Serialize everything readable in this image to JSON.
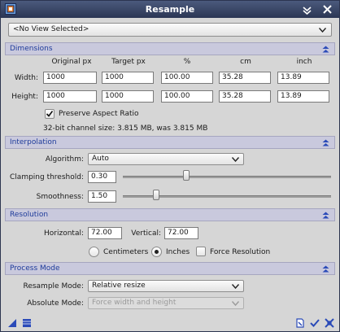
{
  "window": {
    "title": "Resample"
  },
  "view_selector": {
    "value": "<No View Selected>"
  },
  "dimensions": {
    "section_label": "Dimensions",
    "col_headers": [
      "Original px",
      "Target px",
      "%",
      "cm",
      "inch"
    ],
    "width_label": "Width:",
    "height_label": "Height:",
    "width_values": [
      "1000",
      "1000",
      "100.00",
      "35.28",
      "13.89"
    ],
    "height_values": [
      "1000",
      "1000",
      "100.00",
      "35.28",
      "13.89"
    ],
    "preserve_aspect_label": "Preserve Aspect Ratio",
    "preserve_aspect_checked": true,
    "channel_size_text": "32-bit channel size: 3.815 MB, was 3.815 MB"
  },
  "interpolation": {
    "section_label": "Interpolation",
    "algorithm_label": "Algorithm:",
    "algorithm_value": "Auto",
    "clamping_label": "Clamping threshold:",
    "clamping_value": "0.30",
    "clamping_level": 0.3,
    "smoothness_label": "Smoothness:",
    "smoothness_value": "1.50",
    "smoothness_level": 0.15
  },
  "resolution": {
    "section_label": "Resolution",
    "horizontal_label": "Horizontal:",
    "horizontal_value": "72.00",
    "vertical_label": "Vertical:",
    "vertical_value": "72.00",
    "unit_options": [
      "Centimeters",
      "Inches"
    ],
    "unit_selected": "Inches",
    "force_resolution_label": "Force Resolution",
    "force_resolution_checked": false
  },
  "process_mode": {
    "section_label": "Process Mode",
    "resample_mode_label": "Resample Mode:",
    "resample_mode_value": "Relative resize",
    "absolute_mode_label": "Absolute Mode:",
    "absolute_mode_value": "Force width and height"
  },
  "colors": {
    "section_text": "#1f3c9b",
    "title_bar": "#2b3654",
    "accent_blue": "#2a4ab8"
  }
}
